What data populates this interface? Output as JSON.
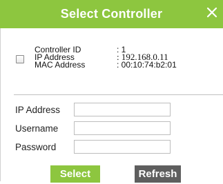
{
  "dialog": {
    "title": "Select Controller",
    "close_icon": "close-icon"
  },
  "controller": {
    "labels": {
      "controller_id": "Controller ID",
      "ip_address": "IP Address",
      "mac_address": "MAC Address"
    },
    "values": {
      "controller_id": ": 1",
      "ip_address": ": 192.168.0.11",
      "mac_address": ": 00:10:74:b2:01"
    },
    "checked": false
  },
  "form": {
    "ip_label": "IP Address",
    "ip_value": "",
    "username_label": "Username",
    "username_value": "",
    "password_label": "Password",
    "password_value": ""
  },
  "buttons": {
    "select_label": "Select",
    "refresh_label": "Refresh"
  },
  "colors": {
    "accent": "#8dc63f",
    "refresh_button": "#5e5e5e"
  }
}
